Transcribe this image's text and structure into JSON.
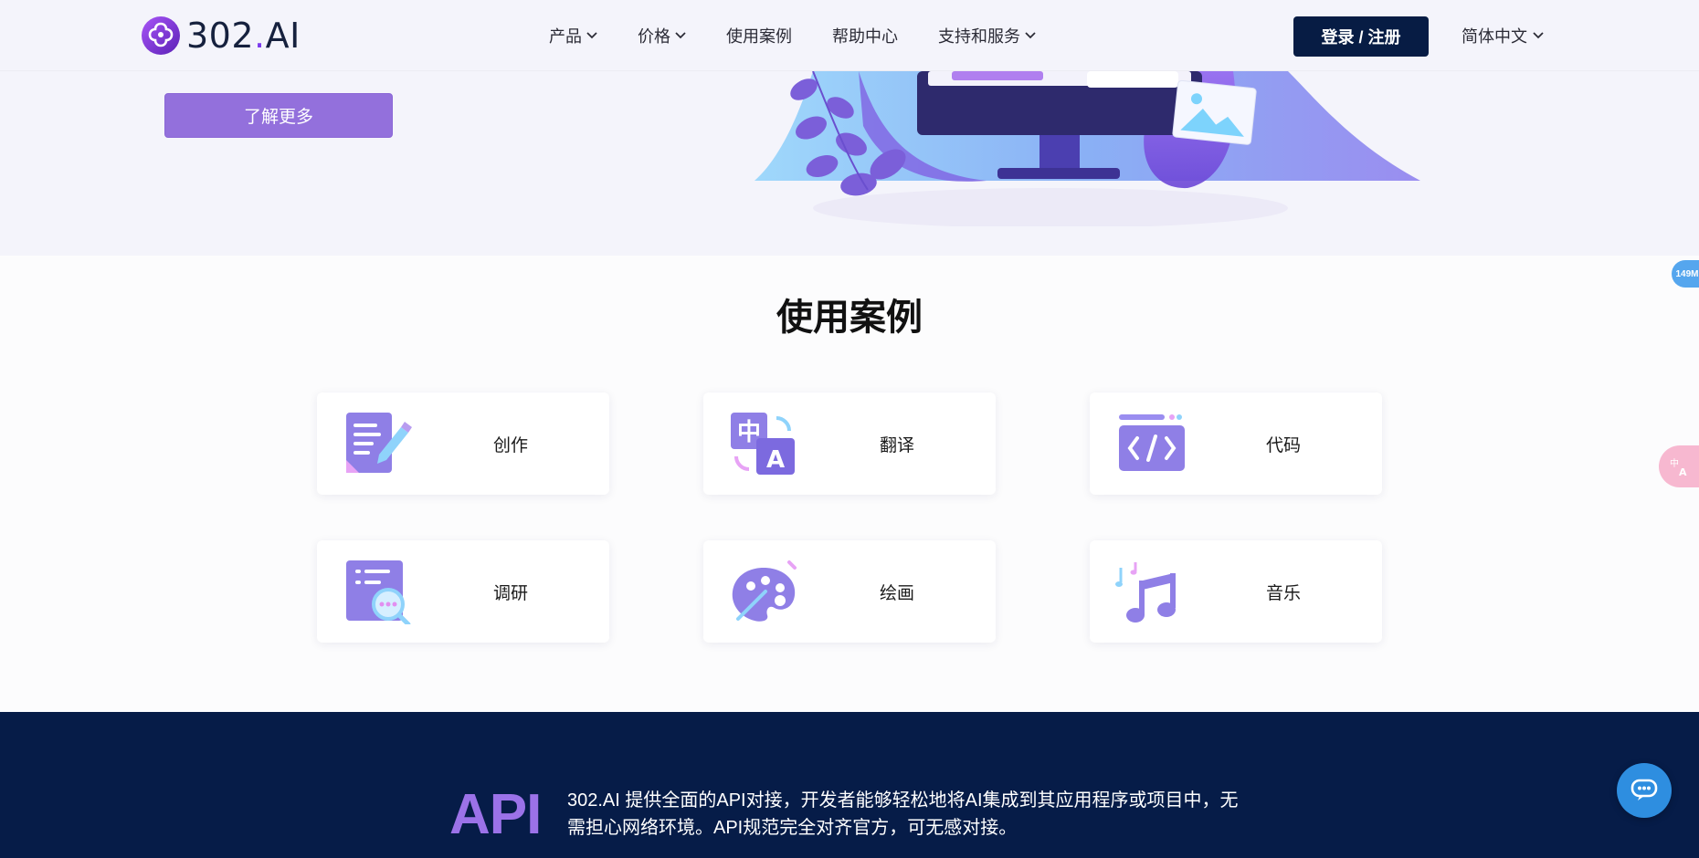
{
  "header": {
    "logo_text": "302",
    "logo_dot": ".",
    "logo_suffix": "AI",
    "nav": [
      {
        "label": "产品",
        "has_dropdown": true
      },
      {
        "label": "价格",
        "has_dropdown": true
      },
      {
        "label": "使用案例",
        "has_dropdown": false
      },
      {
        "label": "帮助中心",
        "has_dropdown": false
      },
      {
        "label": "支持和服务",
        "has_dropdown": true
      }
    ],
    "login_label": "登录 / 注册",
    "language": "简体中文"
  },
  "hero": {
    "learn_more": "了解更多"
  },
  "cases": {
    "title": "使用案例",
    "items": [
      {
        "label": "创作",
        "icon": "document-pen-icon"
      },
      {
        "label": "翻译",
        "icon": "translate-icon"
      },
      {
        "label": "代码",
        "icon": "code-icon"
      },
      {
        "label": "调研",
        "icon": "research-magnifier-icon"
      },
      {
        "label": "绘画",
        "icon": "palette-icon"
      },
      {
        "label": "音乐",
        "icon": "music-note-icon"
      }
    ]
  },
  "floating": {
    "memory_badge": "149M"
  },
  "api": {
    "title": "API",
    "description": "302.AI 提供全面的API对接，开发者能够轻松地将AI集成到其应用程序或项目中，无需担心网络环境。API规范完全对齐官方，可无感对接。"
  },
  "colors": {
    "brand_purple": "#9370dc",
    "navy": "#071c44",
    "api_band": "#061c48",
    "accent_violet": "#7c3aed"
  }
}
